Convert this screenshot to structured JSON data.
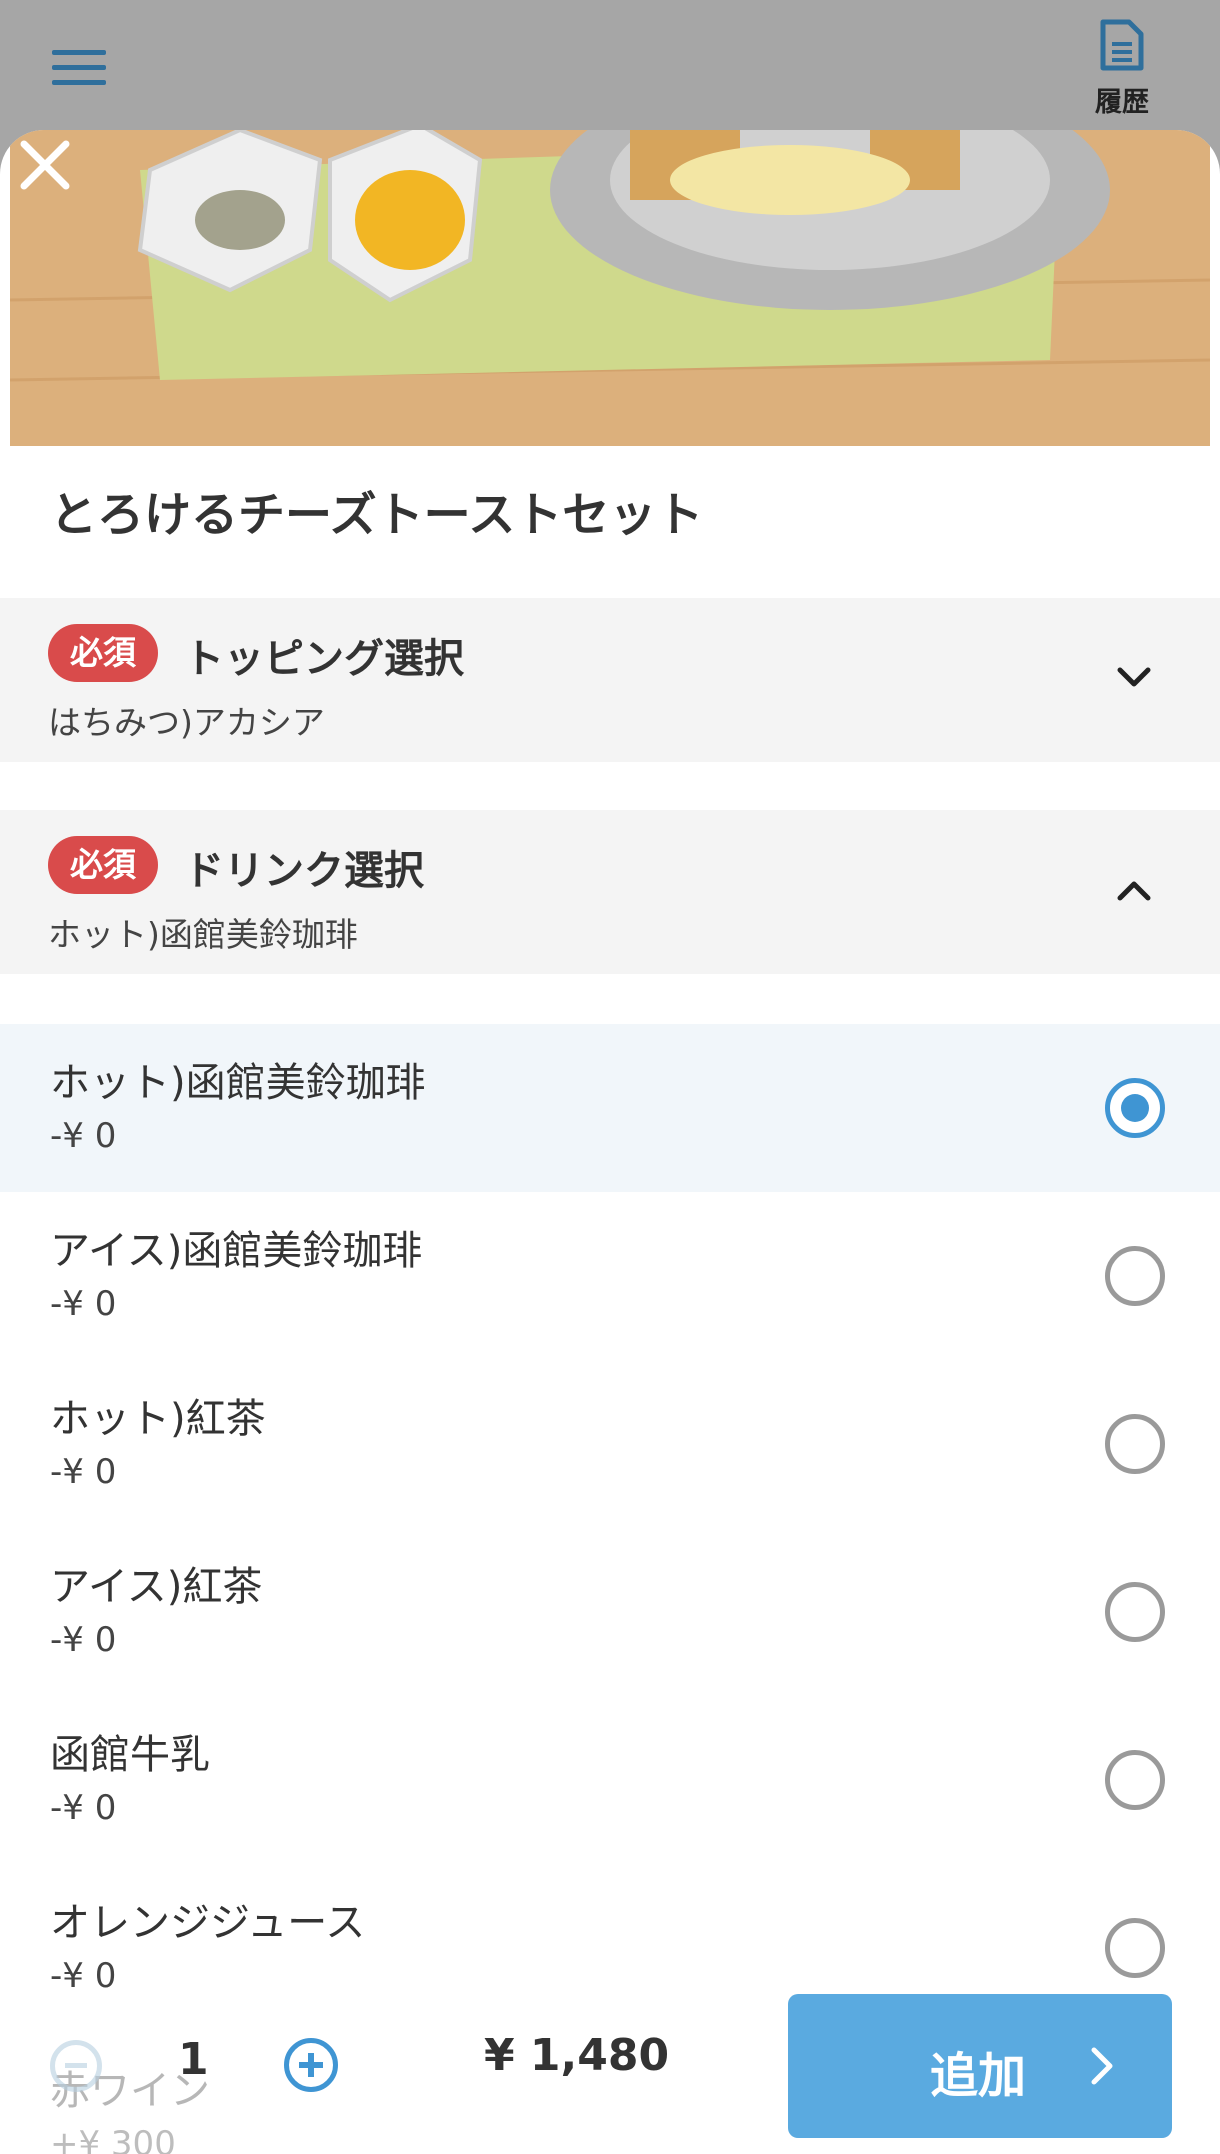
{
  "header": {
    "menu_icon": "hamburger-icon",
    "history_icon": "document-icon",
    "history_label": "履歴"
  },
  "product": {
    "title": "とろけるチーズトーストセット",
    "image": "cheese-toast-photo"
  },
  "groups": [
    {
      "badge": "必須",
      "title": "トッピング選択",
      "selected": "はちみつ)アカシア",
      "expanded": false
    },
    {
      "badge": "必須",
      "title": "ドリンク選択",
      "selected": "ホット)函館美鈴珈琲",
      "expanded": true
    }
  ],
  "options": [
    {
      "name": "ホット)函館美鈴珈琲",
      "price": "-¥ 0",
      "selected": true
    },
    {
      "name": "アイス)函館美鈴珈琲",
      "price": "-¥ 0",
      "selected": false
    },
    {
      "name": "ホット)紅茶",
      "price": "-¥ 0",
      "selected": false
    },
    {
      "name": "アイス)紅茶",
      "price": "-¥ 0",
      "selected": false
    },
    {
      "name": "函館牛乳",
      "price": "-¥ 0",
      "selected": false
    },
    {
      "name": "オレンジジュース",
      "price": "-¥ 0",
      "selected": false
    },
    {
      "name": "赤ワイン",
      "price": "+¥ 300",
      "selected": false
    }
  ],
  "footer": {
    "quantity": "1",
    "total": "¥ 1,480",
    "add_label": "追加"
  },
  "colors": {
    "accent": "#3f95d3",
    "button": "#5aaae0",
    "required_badge": "#d94b4b"
  }
}
